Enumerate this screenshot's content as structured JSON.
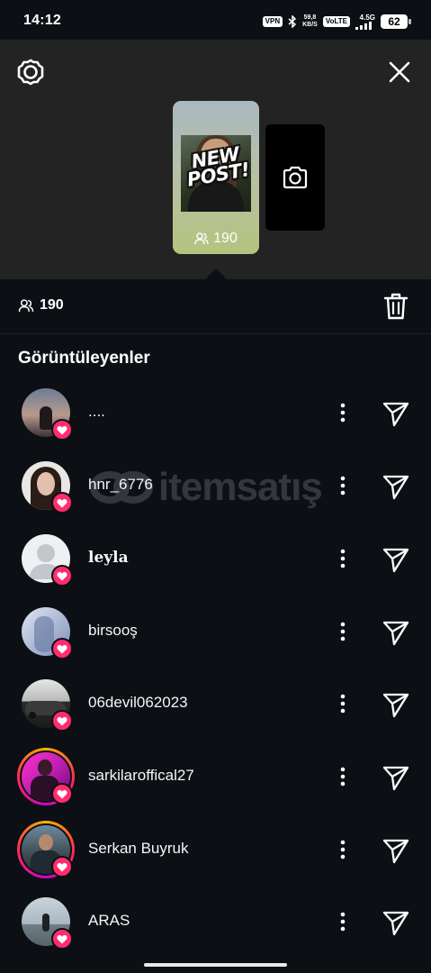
{
  "status_bar": {
    "time": "14:12",
    "vpn": "VPN",
    "speed_top": "59,8",
    "speed_bottom": "KB/S",
    "volte": "VoLTE",
    "network": "4.5G",
    "battery": "62"
  },
  "header": {
    "settings_icon": "gear-icon",
    "close_icon": "close-icon"
  },
  "story": {
    "sticker_line1": "NEW",
    "sticker_line2": "POST!",
    "view_count": "190"
  },
  "count_bar": {
    "viewers": "190",
    "viewers_icon": "people-icon",
    "delete_icon": "trash-icon"
  },
  "section_title": "Görüntüleyenler",
  "watermark": "itemsatış",
  "viewers": [
    {
      "name": "....",
      "liked": true
    },
    {
      "name": "hnr_6776",
      "liked": true
    },
    {
      "name": "leyla",
      "liked": true
    },
    {
      "name": "birsooş",
      "liked": true
    },
    {
      "name": "06devil062023",
      "liked": true
    },
    {
      "name": "sarkilaroffical27",
      "liked": true
    },
    {
      "name": "Serkan Buyruk",
      "liked": true
    },
    {
      "name": "ARAS",
      "liked": true
    }
  ],
  "colors": {
    "background": "#0c0f14",
    "top_panel": "#232323",
    "like_badge": "#ff2d6f"
  }
}
